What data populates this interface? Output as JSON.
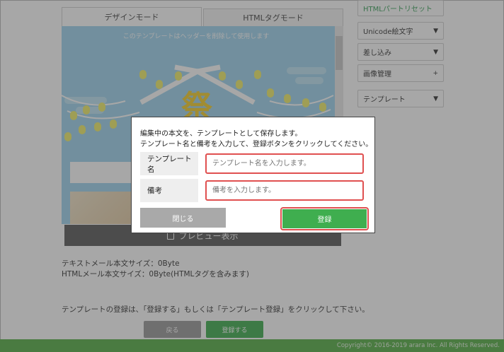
{
  "tabs": [
    {
      "label": "デザインモード",
      "active": true
    },
    {
      "label": "HTMLタグモード",
      "active": false
    }
  ],
  "editor": {
    "header_note": "このテンプレートはヘッダーを削除して使用します",
    "festival_char": "祭"
  },
  "preview_button": {
    "label": "プレビュー表示"
  },
  "sidebar": [
    {
      "label": "HTMLパートリセット",
      "indicator": "",
      "style": "green"
    },
    {
      "label": "Unicode絵文字",
      "indicator": "▼"
    },
    {
      "label": "差し込み",
      "indicator": "▼"
    },
    {
      "label": "画像管理",
      "indicator": "+"
    },
    {
      "label": "テンプレート",
      "indicator": "▼"
    }
  ],
  "info": {
    "text_size": "テキストメール本文サイズ：0Byte",
    "html_size": "HTMLメール本文サイズ：0Byte(HTMLタグを含みます)",
    "template_note": "テンプレートの登録は、「登録する」もしくは「テンプレート登録」をクリックして下さい。"
  },
  "bottom_buttons": {
    "back": "戻る",
    "register": "登録する"
  },
  "footer": {
    "copyright": "Copyright© 2016-2019 arara Inc. All Rights Reserved."
  },
  "dialog": {
    "message_line1": "編集中の本文を、テンプレートとして保存します。",
    "message_line2": "テンプレート名と備考を入力して、登録ボタンをクリックしてください。",
    "name_label": "テンプレート名",
    "name_placeholder": "テンプレート名を入力します。",
    "note_label": "備考",
    "note_placeholder": "備考を入力します。",
    "close_label": "閉じる",
    "register_label": "登録"
  },
  "colors": {
    "accent_green": "#3fae4f",
    "highlight_red": "#e05050",
    "editor_bg": "#9fd4ee",
    "festival_yellow": "#f4ce2a"
  }
}
